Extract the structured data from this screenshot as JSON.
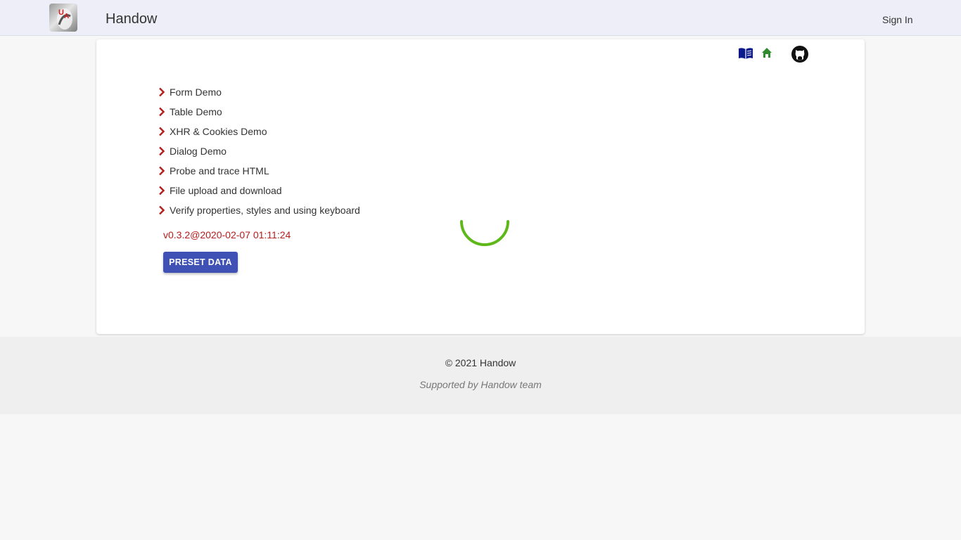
{
  "app": {
    "title": "Handow",
    "logo_icon": "handow-logo",
    "sign_in_label": "Sign In"
  },
  "toolbar_icons": [
    {
      "name": "book-icon",
      "color": "#0d1a8c"
    },
    {
      "name": "home-icon",
      "color": "#2e8b2e"
    },
    {
      "name": "github-icon",
      "color": "#111111"
    }
  ],
  "menu": {
    "chevron_color": "#b71c1c",
    "items": [
      {
        "label": "Form Demo"
      },
      {
        "label": "Table Demo"
      },
      {
        "label": "XHR & Cookies Demo"
      },
      {
        "label": "Dialog Demo"
      },
      {
        "label": "Probe and trace HTML"
      },
      {
        "label": "File upload and download"
      },
      {
        "label": "Verify properties, styles and using keyboard"
      }
    ]
  },
  "version": "v0.3.2@2020-02-07 01:11:24",
  "preset_button_label": "PRESET DATA",
  "spinner": {
    "color": "#5fb81a"
  },
  "footer": {
    "copyright": "© 2021 Handow",
    "supported": "Supported by Handow team"
  }
}
